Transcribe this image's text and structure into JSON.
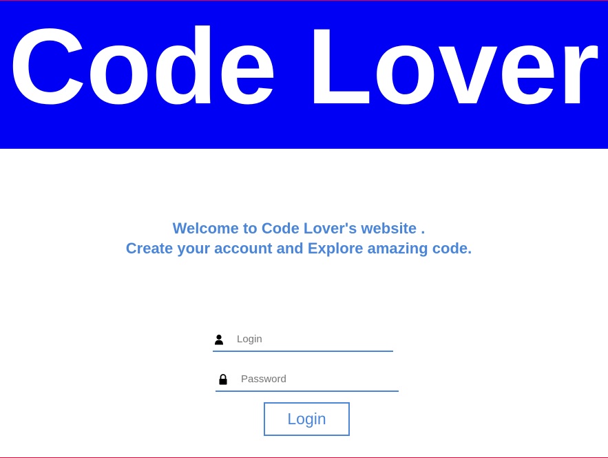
{
  "header": {
    "title": "Code Lover"
  },
  "welcome": {
    "line1": "Welcome to Code Lover's website .",
    "line2": "Create your account and Explore amazing code."
  },
  "form": {
    "login": {
      "placeholder": "Login",
      "value": "",
      "icon": "user-icon"
    },
    "password": {
      "placeholder": "Password",
      "value": "",
      "icon": "lock-icon"
    },
    "submit_label": "Login"
  },
  "colors": {
    "banner": "#0000f5",
    "banner_text": "#ffffff",
    "accent": "#4a85d8",
    "page_border": "#e8003c"
  }
}
